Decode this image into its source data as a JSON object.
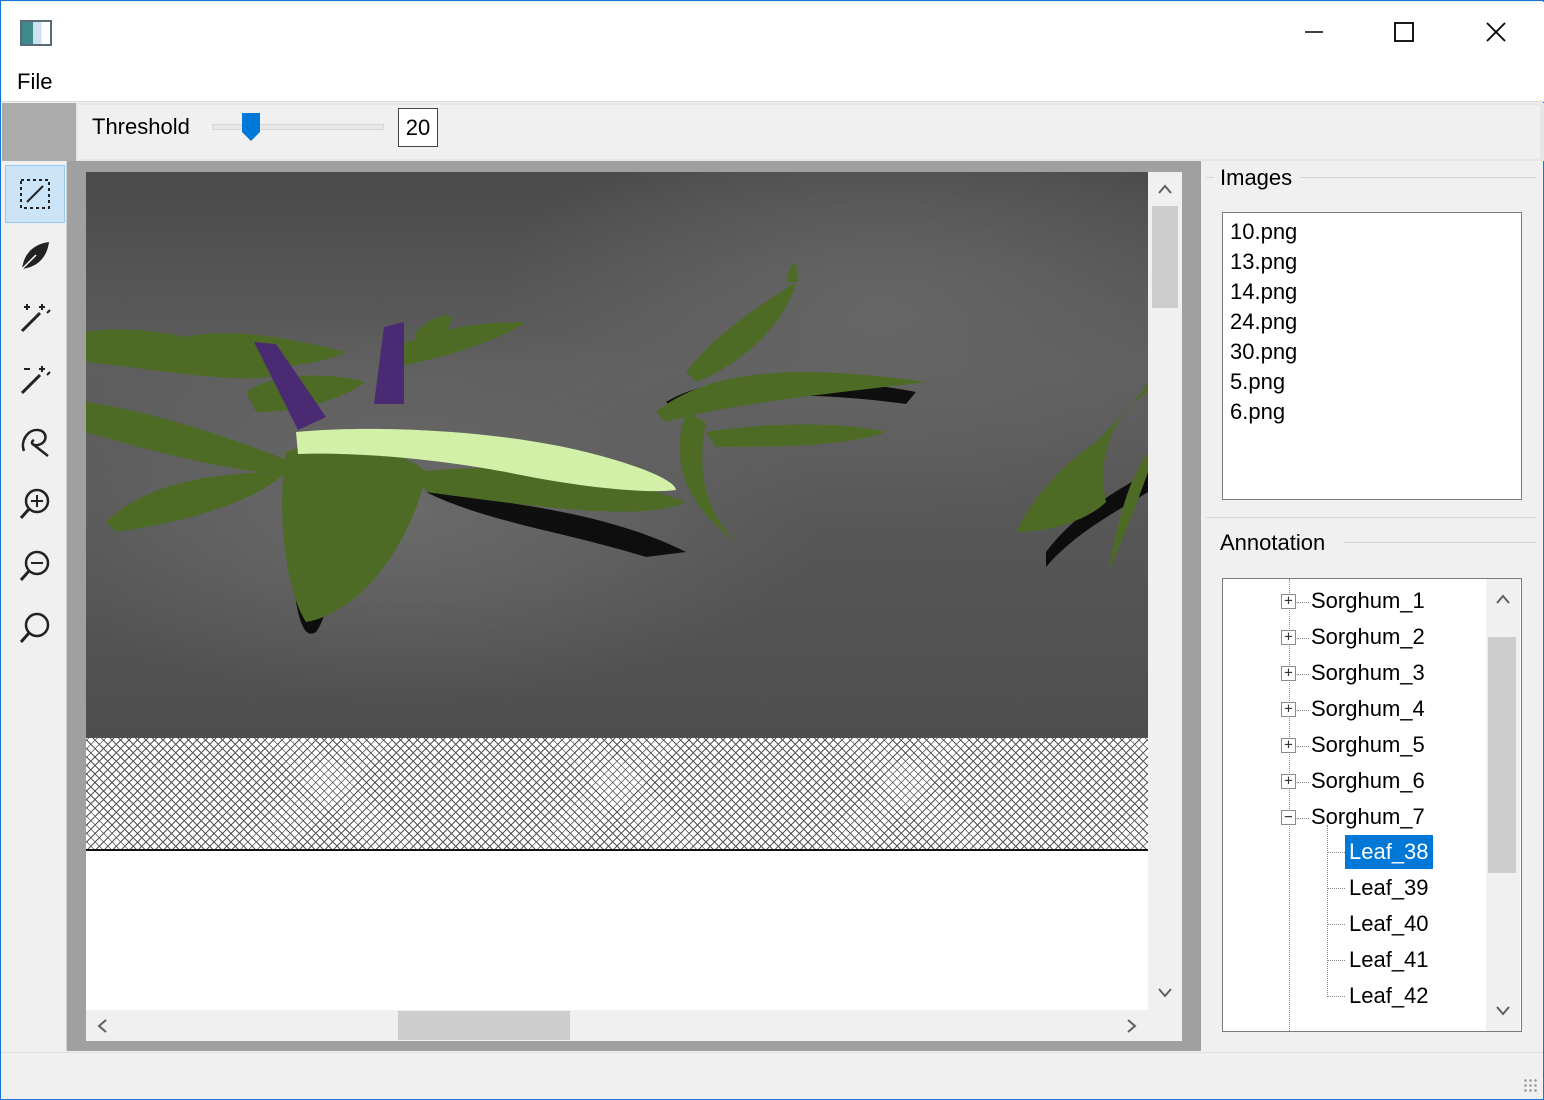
{
  "menu": {
    "file": "File"
  },
  "toolbar": {
    "threshold_label": "Threshold",
    "threshold_value": "20",
    "threshold_level_fraction": 0.2
  },
  "tools": [
    "select-box-icon",
    "leaf-icon",
    "magic-wand-add-icon",
    "magic-wand-remove-icon",
    "lasso-icon",
    "zoom-in-icon",
    "zoom-out-icon",
    "zoom-fit-icon"
  ],
  "images": {
    "title": "Images",
    "items": [
      "10.png",
      "13.png",
      "14.png",
      "24.png",
      "30.png",
      "5.png",
      "6.png"
    ]
  },
  "annotation": {
    "title": "Annotation",
    "nodes": [
      {
        "label": "Sorghum_1",
        "expanded": false
      },
      {
        "label": "Sorghum_2",
        "expanded": false
      },
      {
        "label": "Sorghum_3",
        "expanded": false
      },
      {
        "label": "Sorghum_4",
        "expanded": false
      },
      {
        "label": "Sorghum_5",
        "expanded": false
      },
      {
        "label": "Sorghum_6",
        "expanded": false
      },
      {
        "label": "Sorghum_7",
        "expanded": true
      },
      {
        "label": "Leaf_38",
        "selected": true
      },
      {
        "label": "Leaf_39"
      },
      {
        "label": "Leaf_40"
      },
      {
        "label": "Leaf_41"
      },
      {
        "label": "Leaf_42"
      }
    ]
  },
  "colors": {
    "selection": "#0078d7",
    "leaf": "#4e6b26",
    "leaf_highlight": "#d3f0a8",
    "stem_marker": "#4a2a72",
    "accent": "#0078d7"
  }
}
